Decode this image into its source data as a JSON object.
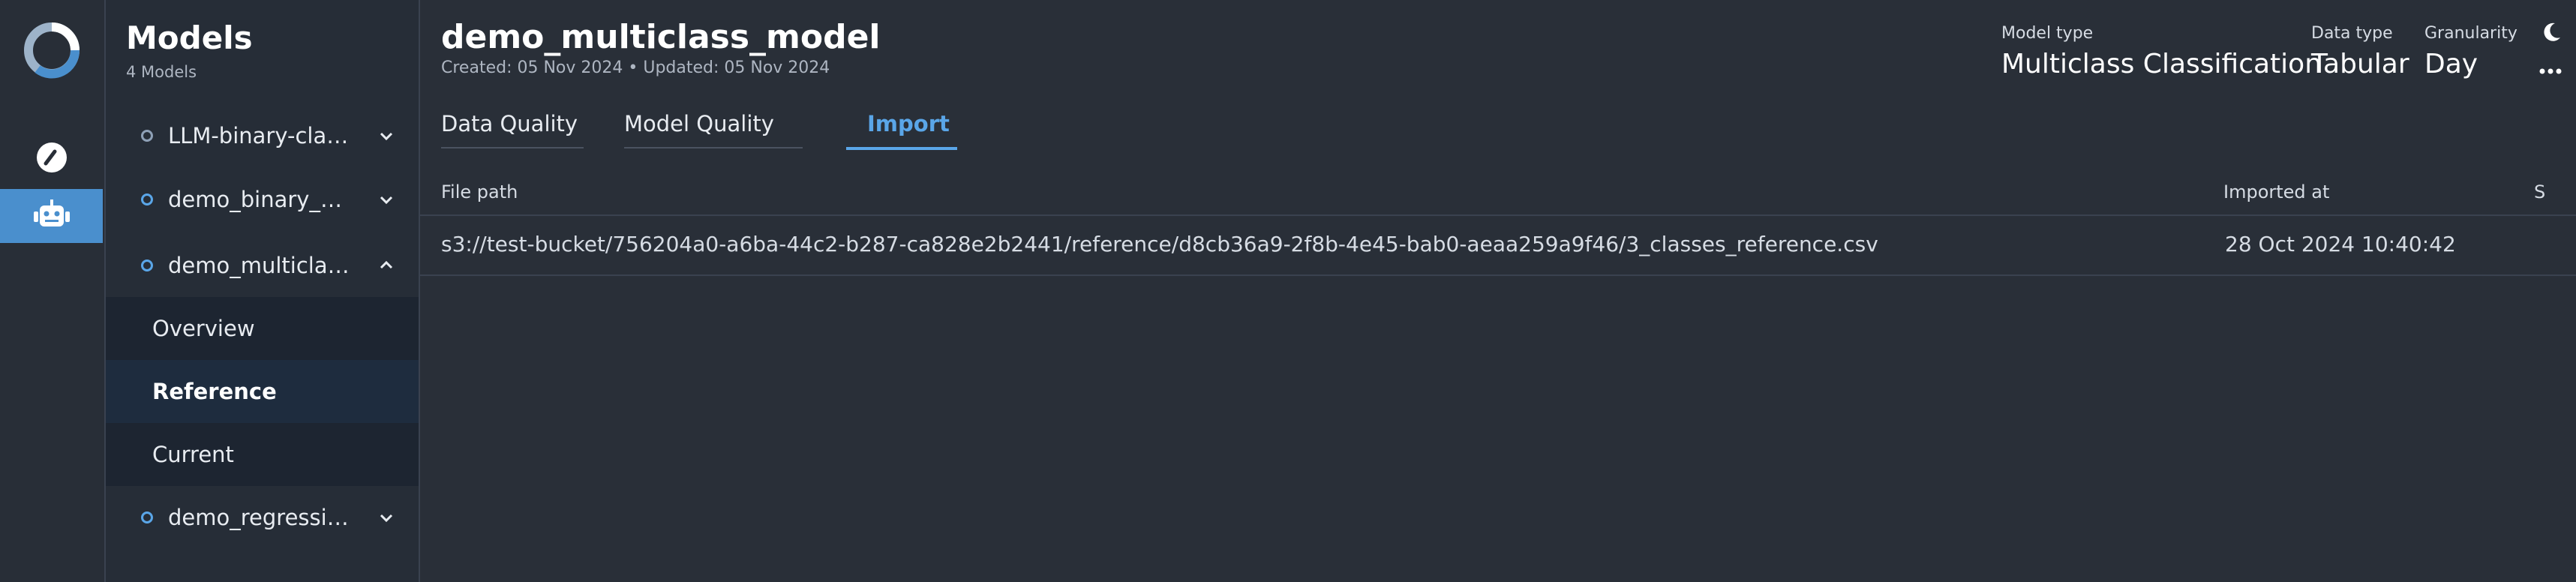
{
  "sidebar": {
    "title": "Models",
    "count": "4 Models",
    "models": [
      {
        "name": "LLM-binary-classi...",
        "status": "gray",
        "expanded": false
      },
      {
        "name": "demo_binary_mo...",
        "status": "blue",
        "expanded": false
      },
      {
        "name": "demo_multiclass_...",
        "status": "blue",
        "expanded": true
      },
      {
        "name": "demo_regression...",
        "status": "blue",
        "expanded": false
      }
    ],
    "sub_items": [
      "Overview",
      "Reference",
      "Current"
    ],
    "active_sub_item": "Reference"
  },
  "header": {
    "title": "demo_multiclass_model",
    "meta": "Created: 05 Nov 2024 • Updated: 05 Nov 2024",
    "model_type_label": "Model type",
    "model_type_value": "Multiclass Classification",
    "data_type_label": "Data type",
    "data_type_value": "Tabular",
    "granularity_label": "Granularity",
    "granularity_value": "Day"
  },
  "tabs": [
    "Data Quality",
    "Model Quality",
    "Import"
  ],
  "active_tab": "Import",
  "table": {
    "columns": [
      "File path",
      "Imported at",
      "S"
    ],
    "rows": [
      [
        "s3://test-bucket/756204a0-a6ba-44c2-b287-ca828e2b2441/reference/d8cb36a9-2f8b-4e45-bab0-aeaa259a9f46/3_classes_reference.csv",
        "28 Oct 2024 10:40:42",
        ""
      ]
    ]
  },
  "colors": {
    "accent": "#5aa6e8",
    "background": "#292f38",
    "sidebar": "#262d37",
    "active_rail": "#4a8fcd"
  },
  "icons": {
    "logo": "app-logo",
    "dashboard": "gauge-icon",
    "models": "robot-icon",
    "theme": "moon-icon",
    "more": "more-horizontal-icon"
  }
}
